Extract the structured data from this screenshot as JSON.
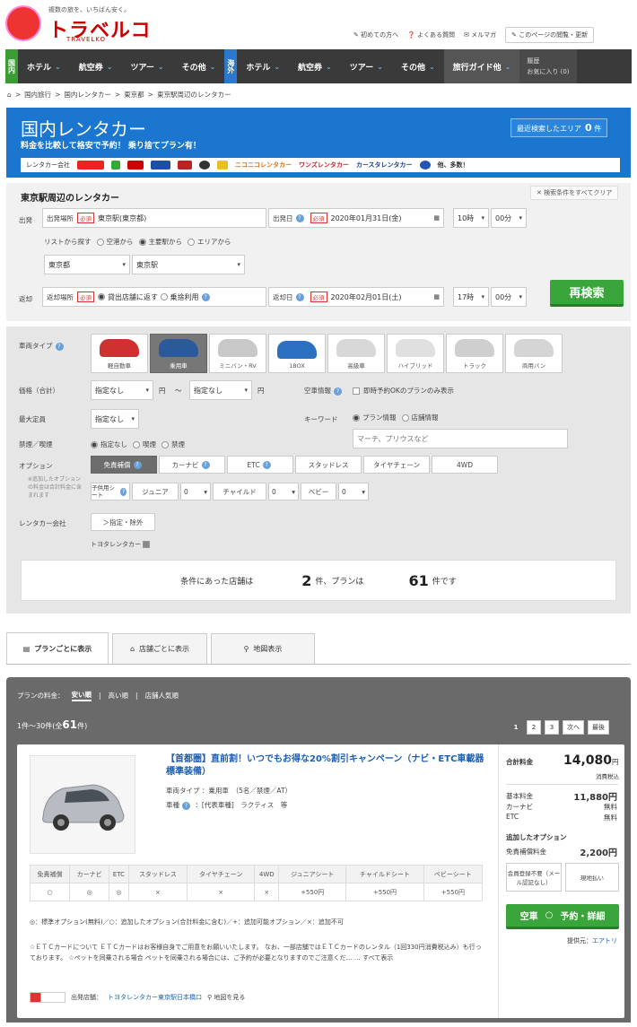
{
  "header": {
    "tagline": "複数の旅を、いちばん安く。",
    "logo_text": "トラベルコ",
    "logo_sub": "TRAVELKO",
    "links": [
      "初めての方へ",
      "よくある質問",
      "メルマガ"
    ],
    "bookmark_btn": "このページの閲覧・更新"
  },
  "nav": {
    "domestic_tag": "国内",
    "overseas_tag": "海外",
    "domestic": [
      "ホテル",
      "航空券",
      "ツアー",
      "その他"
    ],
    "overseas": [
      "ホテル",
      "航空券",
      "ツアー",
      "その他"
    ],
    "guide": "旅行ガイド他",
    "history": "履歴",
    "favorites": "お気に入り (0)"
  },
  "breadcrumb": [
    "国内旅行",
    "国内レンタカー",
    "東京都",
    "東京駅周辺のレンタカー"
  ],
  "banner": {
    "title": "国内レンタカー",
    "subtitle": "料金を比較して格安で予約！ 乗り捨てプラン有！",
    "recent_label": "最近検索したエリア",
    "recent_count": "0",
    "recent_unit": "件",
    "company_label": "レンタカー会社",
    "companies": [
      "ニコニコレンタカー",
      "ワンズレンタカー",
      "カースタレンタカー"
    ],
    "others": "他、多数！"
  },
  "search": {
    "title": "東京駅周辺のレンタカー",
    "clear_all": "検索条件をすべてクリア",
    "depart_label": "出発",
    "depart_place_label": "出発場所",
    "required": "必須",
    "depart_place": "東京駅(東京都)",
    "depart_date_label": "出発日",
    "depart_date": "2020年01月31日(金)",
    "depart_hour": "10時",
    "depart_min": "00分",
    "list_label": "リストから探す",
    "list_opts": [
      "空港から",
      "主要駅から",
      "エリアから"
    ],
    "pref": "東京都",
    "station": "東京駅",
    "return_label": "返却",
    "return_place_label": "返却場所",
    "return_opts": [
      "貸出店舗に返す",
      "乗捨利用"
    ],
    "return_date_label": "返却日",
    "return_date": "2020年02月01日(土)",
    "return_hour": "17時",
    "return_min": "00分",
    "research": "再検索"
  },
  "filter": {
    "vehicle_type_label": "車両タイプ",
    "vehicles": [
      {
        "label": "軽自動車",
        "color": "#d03030"
      },
      {
        "label": "乗用車",
        "color": "#2a5a9a"
      },
      {
        "label": "ミニバン・RV",
        "color": "#c8c8c8"
      },
      {
        "label": "1BOX",
        "color": "#2a6fc0"
      },
      {
        "label": "高級車",
        "color": "#d8d8d8"
      },
      {
        "label": "ハイブリッド",
        "color": "#e0e0e0"
      },
      {
        "label": "トラック",
        "color": "#cfcfcf"
      },
      {
        "label": "商用バン",
        "color": "#d5d5d5"
      }
    ],
    "price_label": "価格（合計）",
    "unspecified": "指定なし",
    "yen": "円",
    "tilde": "〜",
    "vacancy_label": "空車情報",
    "vacancy_check": "即時予約OKのプランのみ表示",
    "capacity_label": "最大定員",
    "keyword_label": "キーワード",
    "keyword_opts": [
      "プラン情報",
      "店舗情報"
    ],
    "keyword_placeholder": "マーチ、プリウスなど",
    "smoking_label": "禁煙／喫煙",
    "smoking_opts": [
      "指定なし",
      "喫煙",
      "禁煙"
    ],
    "option_label": "オプション",
    "option_note": "※追加したオプションの料金は合計料金に含まれます",
    "options": [
      "免責補償",
      "カーナビ",
      "ETC",
      "スタッドレス",
      "タイヤチェーン",
      "4WD"
    ],
    "child_seat_label": "子供用シート",
    "junior": "ジュニア",
    "child": "チャイルド",
    "baby": "ベビー",
    "zero": "0",
    "company_label": "レンタカー会社",
    "company_btn": "＞指定・除外",
    "company_tag": "トヨタレンタカー",
    "result_pre": "条件にあった店舗は",
    "store_count": "2",
    "result_mid": "件、プランは",
    "plan_count": "61",
    "result_post": "件です"
  },
  "tabs": [
    "プランごとに表示",
    "店舗ごとに表示",
    "地図表示"
  ],
  "results": {
    "sort_label": "プランの料金：",
    "sort_opts": [
      "安い順",
      "高い順",
      "店舗人気順"
    ],
    "range_pre": "1件〜30件(全",
    "range_total": "61",
    "range_post": "件)",
    "pages": [
      "1",
      "2",
      "3",
      "次へ",
      "最後"
    ],
    "plan": {
      "title": "【首都圏】直前割！いつでもお得な20%割引キャンペーン（ナビ・ETC車載器標準装備）",
      "type_label": "車両タイプ",
      "type_value": "：乗用車　（5名／禁煙／AT）",
      "car_label": "車種",
      "car_value": "：[代表車種]　ラクティス　等",
      "opt_headers": [
        "免責補償",
        "カーナビ",
        "ETC",
        "スタッドレス",
        "タイヤチェーン",
        "4WD",
        "ジュニアシート",
        "チャイルドシート",
        "ベビーシート"
      ],
      "opt_values": [
        "○",
        "◎",
        "◎",
        "×",
        "×",
        "×",
        "+550円",
        "+550円",
        "+550円"
      ],
      "legend": "◎：標準オプション(無料)／○：追加したオプション(合計料金に含む)／+：追加可能オプション／×：追加不可",
      "etc_note": "☆ＥＴＣカードについて ＥＴＣカードはお客様自身でご用意をお願いいたします。 なお、一部店舗ではＥＴＣカードのレンタル（1回330円消費税込み）も行っております。 ☆ペットを同乗される場合 ペットを同乗される場合には、ご予約が必要となりますのでご注意くだ… … すべて表示",
      "store_label": "出発店舗：",
      "store_name": "トヨタレンタカー東京駅日本橋口",
      "map_link": "地図を見る",
      "total_label": "合計料金",
      "total_price": "14,080",
      "total_unit": "円",
      "tax_note": "消費税込",
      "base_label": "基本料金",
      "base_price": "11,880円",
      "nav_label": "カーナビ",
      "nav_price": "無料",
      "etc_label": "ETC",
      "etc_price": "無料",
      "added_label": "追加したオプション",
      "cdw_label": "免責補償料金",
      "cdw_price": "2,200円",
      "member_box": "会員登録不要（メール認証なし）",
      "pay_box": "現地払い",
      "vacancy": "空車",
      "reserve": "予約・詳細",
      "provider_label": "提供元：",
      "provider": "エアトリ"
    }
  }
}
